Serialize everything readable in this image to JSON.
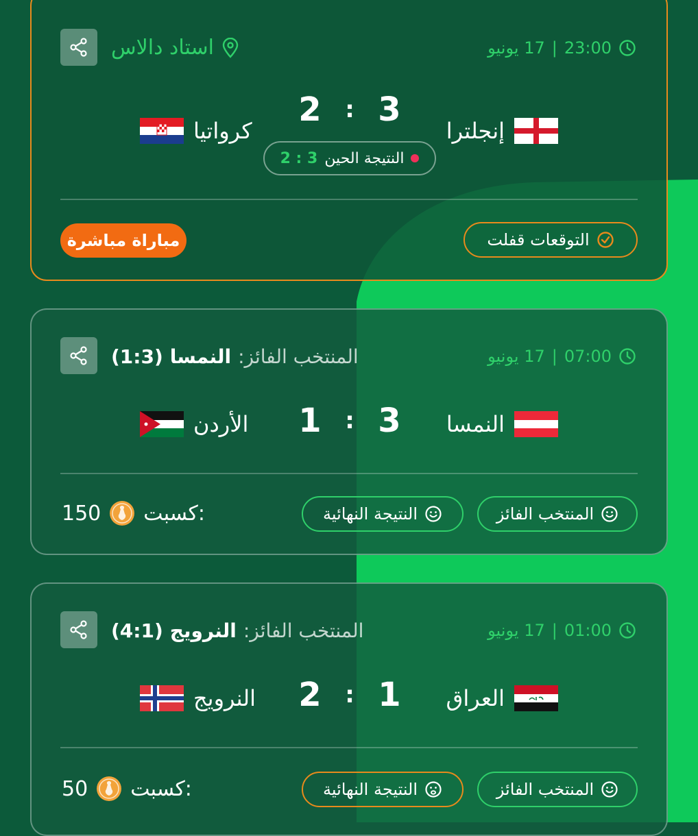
{
  "matches": [
    {
      "time_icon": "clock-icon",
      "time": "23:00",
      "date": "17 يونيو",
      "venue_icon": "location-pin-icon",
      "venue": "استاد دالاس",
      "home_team": "إنجلترا",
      "home_flag": "england-flag",
      "home_score": "3",
      "away_team": "كرواتيا",
      "away_flag": "croatia-flag",
      "away_score": "2",
      "live_label": "النتيجة الحين",
      "live_score": "2 : 3",
      "predictions_locked_label": "التوقعات قفلت",
      "live_match_label": "مباراة مباشرة"
    },
    {
      "time_icon": "clock-icon",
      "time": "07:00",
      "date": "17 يونيو",
      "winner_label": "المنتخب الفائز:",
      "winner_team": "النمسا",
      "winner_score": "(1:3)",
      "home_team": "النمسا",
      "home_flag": "austria-flag",
      "home_score": "3",
      "away_team": "الأردن",
      "away_flag": "jordan-flag",
      "away_score": "1",
      "pick_winner_label": "المنتخب الفائز",
      "pick_result_label": "النتيجة النهائية",
      "earned_label": "كسبت:",
      "earned_points": "150"
    },
    {
      "time_icon": "clock-icon",
      "time": "01:00",
      "date": "17 يونيو",
      "winner_label": "المنتخب الفائز:",
      "winner_team": "النرويج",
      "winner_score": "(4:1)",
      "home_team": "العراق",
      "home_flag": "iraq-flag",
      "home_score": "1",
      "away_team": "النرويج",
      "away_flag": "norway-flag",
      "away_score": "2",
      "pick_winner_label": "المنتخب الفائز",
      "pick_result_label": "النتيجة النهائية",
      "earned_label": "كسبت:",
      "earned_points": "50"
    }
  ],
  "colors": {
    "background": "#0c5a3a",
    "accent_green": "#2fd06a",
    "accent_orange": "#e98a1c",
    "live_button": "#f26b12",
    "live_dot": "#f0305a"
  }
}
